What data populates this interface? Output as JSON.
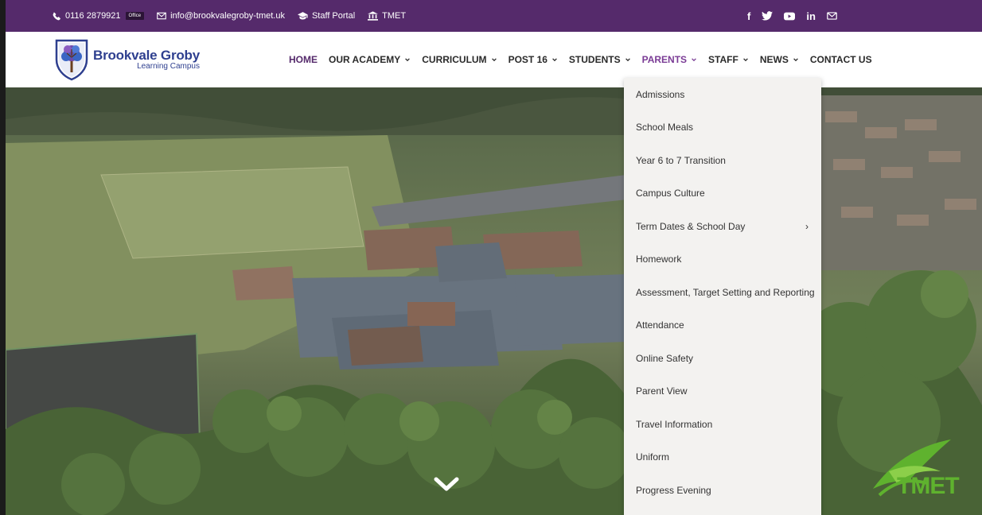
{
  "topbar": {
    "phone": "0116 2879921",
    "phone_badge": "Office",
    "email": "info@brookvalegroby-tmet.uk",
    "staff_portal": "Staff Portal",
    "tmet": "TMET",
    "social": [
      "facebook-icon",
      "twitter-icon",
      "youtube-icon",
      "linkedin-icon",
      "mail-icon"
    ],
    "social_labels": {
      "facebook": "f",
      "linkedin": "in"
    }
  },
  "logo": {
    "title": "Brookvale Groby",
    "subtitle": "Learning Campus"
  },
  "nav": {
    "items": [
      {
        "label": "HOME",
        "has_menu": false
      },
      {
        "label": "OUR ACADEMY",
        "has_menu": true
      },
      {
        "label": "CURRICULUM",
        "has_menu": true
      },
      {
        "label": "POST 16",
        "has_menu": true
      },
      {
        "label": "STUDENTS",
        "has_menu": true
      },
      {
        "label": "PARENTS",
        "has_menu": true
      },
      {
        "label": "STAFF",
        "has_menu": true
      },
      {
        "label": "NEWS",
        "has_menu": true
      },
      {
        "label": "CONTACT US",
        "has_menu": false
      }
    ]
  },
  "parents_menu": {
    "items": [
      {
        "label": "Admissions"
      },
      {
        "label": "School Meals"
      },
      {
        "label": "Year 6 to 7 Transition"
      },
      {
        "label": "Campus Culture"
      },
      {
        "label": "Term Dates & School Day",
        "submenu_arrow": "›"
      },
      {
        "label": "Homework"
      },
      {
        "label": "Assessment, Target Setting and Reporting"
      },
      {
        "label": "Attendance"
      },
      {
        "label": "Online Safety"
      },
      {
        "label": "Parent View"
      },
      {
        "label": "Travel Information"
      },
      {
        "label": "Uniform"
      },
      {
        "label": "Progress Evening"
      }
    ]
  },
  "tmet_logo": "TMET",
  "colors": {
    "topbar": "#552a6b",
    "nav_active": "#552a6b",
    "nav_open": "#7a3b95",
    "logo_text": "#2e3f8f",
    "tmet_green": "#5fb22e",
    "dropdown_bg": "#f3f2f0"
  }
}
